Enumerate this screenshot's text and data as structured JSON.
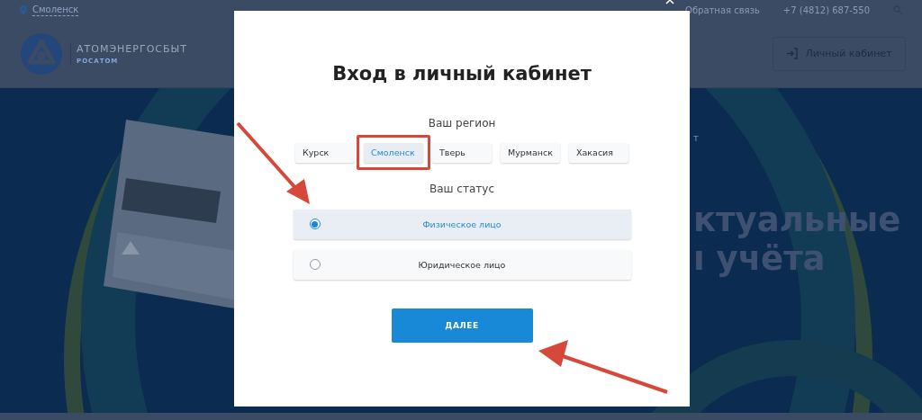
{
  "header": {
    "city": "Смоленск",
    "brand": "АТОМЭНЕРГОСБЫТ",
    "brand_sub": "РОСАТОМ",
    "links": [
      "Обратная связь",
      "+7 (4812) 687-550"
    ],
    "account_button": "Личный кабинет"
  },
  "hero": {
    "kicker": "т",
    "lines": [
      "ктуальные",
      "ı учёта"
    ]
  },
  "modal": {
    "title": "Вход в личный кабинет",
    "region_label": "Ваш регион",
    "regions": [
      {
        "label": "Курск",
        "selected": false,
        "highlighted": false
      },
      {
        "label": "Смоленск",
        "selected": true,
        "highlighted": true
      },
      {
        "label": "Тверь",
        "selected": false,
        "highlighted": false
      },
      {
        "label": "Мурманск",
        "selected": false,
        "highlighted": false
      },
      {
        "label": "Хакасия",
        "selected": false,
        "highlighted": false
      }
    ],
    "status_label": "Ваш статус",
    "statuses": [
      {
        "label": "Физическое лицо",
        "selected": true
      },
      {
        "label": "Юридическое лицо",
        "selected": false
      }
    ],
    "submit": "ДАЛЕЕ"
  }
}
